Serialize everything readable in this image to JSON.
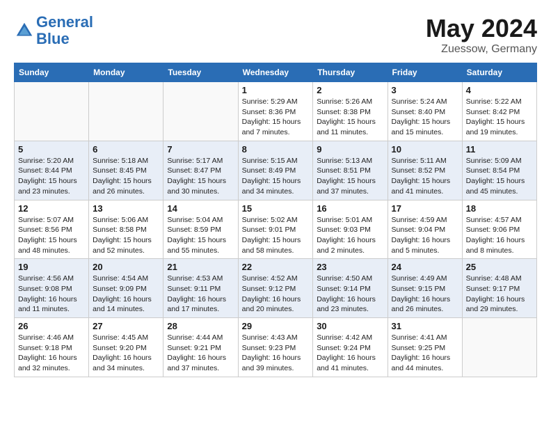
{
  "header": {
    "logo_line1": "General",
    "logo_line2": "Blue",
    "month_year": "May 2024",
    "location": "Zuessow, Germany"
  },
  "weekdays": [
    "Sunday",
    "Monday",
    "Tuesday",
    "Wednesday",
    "Thursday",
    "Friday",
    "Saturday"
  ],
  "weeks": [
    [
      {
        "day": "",
        "sunrise": "",
        "sunset": "",
        "daylight": ""
      },
      {
        "day": "",
        "sunrise": "",
        "sunset": "",
        "daylight": ""
      },
      {
        "day": "",
        "sunrise": "",
        "sunset": "",
        "daylight": ""
      },
      {
        "day": "1",
        "sunrise": "Sunrise: 5:29 AM",
        "sunset": "Sunset: 8:36 PM",
        "daylight": "Daylight: 15 hours and 7 minutes."
      },
      {
        "day": "2",
        "sunrise": "Sunrise: 5:26 AM",
        "sunset": "Sunset: 8:38 PM",
        "daylight": "Daylight: 15 hours and 11 minutes."
      },
      {
        "day": "3",
        "sunrise": "Sunrise: 5:24 AM",
        "sunset": "Sunset: 8:40 PM",
        "daylight": "Daylight: 15 hours and 15 minutes."
      },
      {
        "day": "4",
        "sunrise": "Sunrise: 5:22 AM",
        "sunset": "Sunset: 8:42 PM",
        "daylight": "Daylight: 15 hours and 19 minutes."
      }
    ],
    [
      {
        "day": "5",
        "sunrise": "Sunrise: 5:20 AM",
        "sunset": "Sunset: 8:44 PM",
        "daylight": "Daylight: 15 hours and 23 minutes."
      },
      {
        "day": "6",
        "sunrise": "Sunrise: 5:18 AM",
        "sunset": "Sunset: 8:45 PM",
        "daylight": "Daylight: 15 hours and 26 minutes."
      },
      {
        "day": "7",
        "sunrise": "Sunrise: 5:17 AM",
        "sunset": "Sunset: 8:47 PM",
        "daylight": "Daylight: 15 hours and 30 minutes."
      },
      {
        "day": "8",
        "sunrise": "Sunrise: 5:15 AM",
        "sunset": "Sunset: 8:49 PM",
        "daylight": "Daylight: 15 hours and 34 minutes."
      },
      {
        "day": "9",
        "sunrise": "Sunrise: 5:13 AM",
        "sunset": "Sunset: 8:51 PM",
        "daylight": "Daylight: 15 hours and 37 minutes."
      },
      {
        "day": "10",
        "sunrise": "Sunrise: 5:11 AM",
        "sunset": "Sunset: 8:52 PM",
        "daylight": "Daylight: 15 hours and 41 minutes."
      },
      {
        "day": "11",
        "sunrise": "Sunrise: 5:09 AM",
        "sunset": "Sunset: 8:54 PM",
        "daylight": "Daylight: 15 hours and 45 minutes."
      }
    ],
    [
      {
        "day": "12",
        "sunrise": "Sunrise: 5:07 AM",
        "sunset": "Sunset: 8:56 PM",
        "daylight": "Daylight: 15 hours and 48 minutes."
      },
      {
        "day": "13",
        "sunrise": "Sunrise: 5:06 AM",
        "sunset": "Sunset: 8:58 PM",
        "daylight": "Daylight: 15 hours and 52 minutes."
      },
      {
        "day": "14",
        "sunrise": "Sunrise: 5:04 AM",
        "sunset": "Sunset: 8:59 PM",
        "daylight": "Daylight: 15 hours and 55 minutes."
      },
      {
        "day": "15",
        "sunrise": "Sunrise: 5:02 AM",
        "sunset": "Sunset: 9:01 PM",
        "daylight": "Daylight: 15 hours and 58 minutes."
      },
      {
        "day": "16",
        "sunrise": "Sunrise: 5:01 AM",
        "sunset": "Sunset: 9:03 PM",
        "daylight": "Daylight: 16 hours and 2 minutes."
      },
      {
        "day": "17",
        "sunrise": "Sunrise: 4:59 AM",
        "sunset": "Sunset: 9:04 PM",
        "daylight": "Daylight: 16 hours and 5 minutes."
      },
      {
        "day": "18",
        "sunrise": "Sunrise: 4:57 AM",
        "sunset": "Sunset: 9:06 PM",
        "daylight": "Daylight: 16 hours and 8 minutes."
      }
    ],
    [
      {
        "day": "19",
        "sunrise": "Sunrise: 4:56 AM",
        "sunset": "Sunset: 9:08 PM",
        "daylight": "Daylight: 16 hours and 11 minutes."
      },
      {
        "day": "20",
        "sunrise": "Sunrise: 4:54 AM",
        "sunset": "Sunset: 9:09 PM",
        "daylight": "Daylight: 16 hours and 14 minutes."
      },
      {
        "day": "21",
        "sunrise": "Sunrise: 4:53 AM",
        "sunset": "Sunset: 9:11 PM",
        "daylight": "Daylight: 16 hours and 17 minutes."
      },
      {
        "day": "22",
        "sunrise": "Sunrise: 4:52 AM",
        "sunset": "Sunset: 9:12 PM",
        "daylight": "Daylight: 16 hours and 20 minutes."
      },
      {
        "day": "23",
        "sunrise": "Sunrise: 4:50 AM",
        "sunset": "Sunset: 9:14 PM",
        "daylight": "Daylight: 16 hours and 23 minutes."
      },
      {
        "day": "24",
        "sunrise": "Sunrise: 4:49 AM",
        "sunset": "Sunset: 9:15 PM",
        "daylight": "Daylight: 16 hours and 26 minutes."
      },
      {
        "day": "25",
        "sunrise": "Sunrise: 4:48 AM",
        "sunset": "Sunset: 9:17 PM",
        "daylight": "Daylight: 16 hours and 29 minutes."
      }
    ],
    [
      {
        "day": "26",
        "sunrise": "Sunrise: 4:46 AM",
        "sunset": "Sunset: 9:18 PM",
        "daylight": "Daylight: 16 hours and 32 minutes."
      },
      {
        "day": "27",
        "sunrise": "Sunrise: 4:45 AM",
        "sunset": "Sunset: 9:20 PM",
        "daylight": "Daylight: 16 hours and 34 minutes."
      },
      {
        "day": "28",
        "sunrise": "Sunrise: 4:44 AM",
        "sunset": "Sunset: 9:21 PM",
        "daylight": "Daylight: 16 hours and 37 minutes."
      },
      {
        "day": "29",
        "sunrise": "Sunrise: 4:43 AM",
        "sunset": "Sunset: 9:23 PM",
        "daylight": "Daylight: 16 hours and 39 minutes."
      },
      {
        "day": "30",
        "sunrise": "Sunrise: 4:42 AM",
        "sunset": "Sunset: 9:24 PM",
        "daylight": "Daylight: 16 hours and 41 minutes."
      },
      {
        "day": "31",
        "sunrise": "Sunrise: 4:41 AM",
        "sunset": "Sunset: 9:25 PM",
        "daylight": "Daylight: 16 hours and 44 minutes."
      },
      {
        "day": "",
        "sunrise": "",
        "sunset": "",
        "daylight": ""
      }
    ]
  ]
}
